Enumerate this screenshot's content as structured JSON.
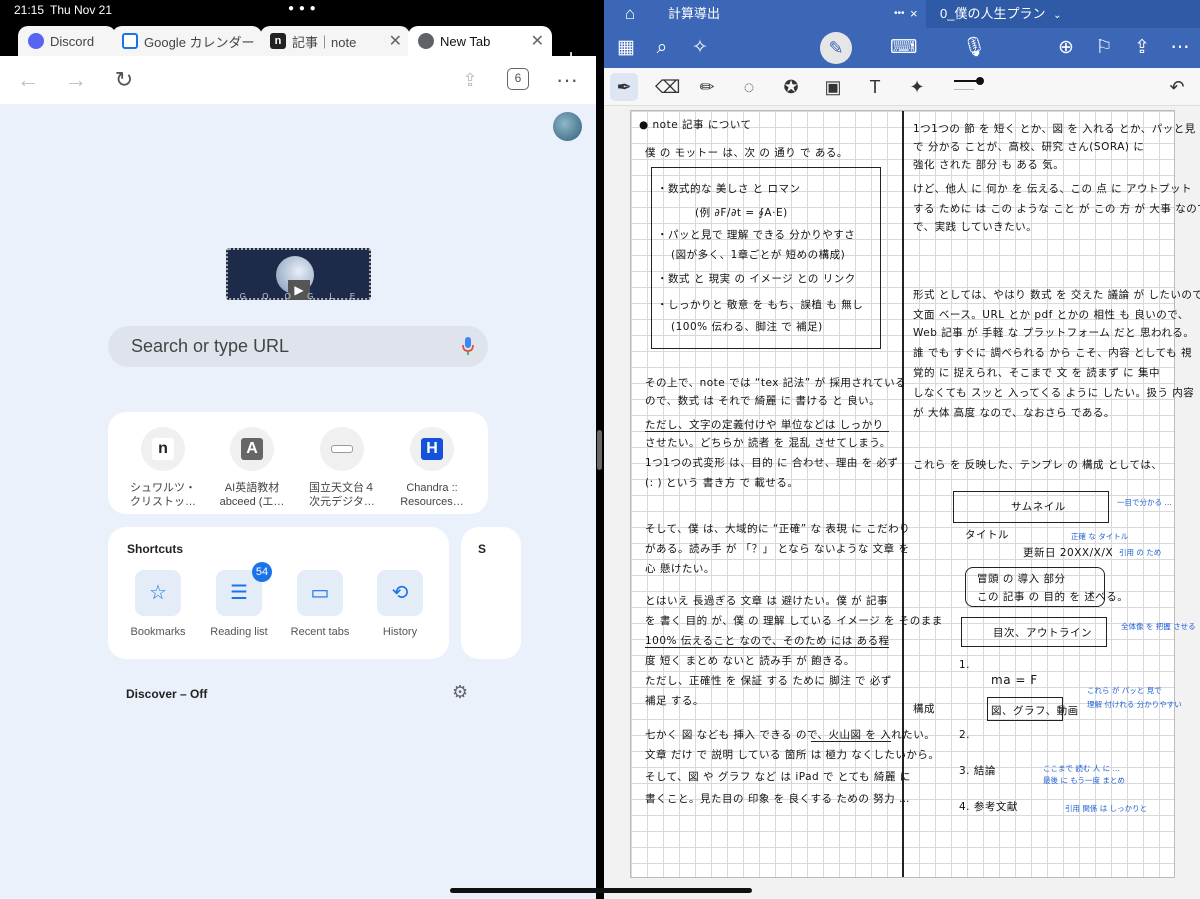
{
  "status": {
    "time": "21:15",
    "date": "Thu Nov 21"
  },
  "chrome": {
    "tabs": [
      {
        "title": "Discord",
        "color": "#5865f2"
      },
      {
        "title": "Google カレンダー",
        "color": "#1a73e8"
      },
      {
        "title": "記事｜note",
        "color": "#222222"
      },
      {
        "title": "New Tab",
        "color": "#5f6368"
      }
    ],
    "tab_count": "6",
    "search_placeholder": "Search or type URL",
    "tiles": [
      {
        "icon_text": "n",
        "label1": "シュワルツ・",
        "label2": "クリストッ…"
      },
      {
        "icon_text": "A",
        "label1": "AI英語教材",
        "label2": "abceed (エ…"
      },
      {
        "icon_text": "",
        "label1": "国立天文台４",
        "label2": "次元デジタ…"
      },
      {
        "icon_text": "H",
        "label1": "Chandra ::",
        "label2": "Resources…"
      }
    ],
    "shortcuts_title": "Shortcuts",
    "shortcuts": [
      {
        "label": "Bookmarks",
        "icon": "star-icon"
      },
      {
        "label": "Reading list",
        "icon": "list-icon",
        "badge": "54"
      },
      {
        "label": "Recent tabs",
        "icon": "devices-icon"
      },
      {
        "label": "History",
        "icon": "history-icon"
      }
    ],
    "next_card_title": "S",
    "discover": "Discover – Off",
    "doodle_letters": "G O O G L E"
  },
  "goodnotes": {
    "tabs": [
      {
        "title": "計算導出"
      },
      {
        "title": "0_僕の人生プラン"
      }
    ],
    "note_left": [
      "● note 記事 について",
      "僕 の モットー は、次 の 通り で ある。",
      "・数式的な 美しさ と ロマン",
      "(例 ∂F/∂t = ∮A·E)",
      "・パッと見で 理解 できる 分かりやすさ",
      "(図が多く、1章ごとが 短めの構成)",
      "・数式 と 現実 の イメージ との リンク",
      "・しっかりと 敬意 を もち、誤植 も 無し",
      "(100% 伝わる、脚注 で 補足)",
      "その上で、note では “tex 記法” が 採用されている",
      "ので、数式 は それで 綺麗 に 書ける と 良い。",
      "ただし、文字の定義付けや 単位などは しっかり",
      "させたい。どちらか 読者 を 混乱 させてしまう。",
      "1つ1つの式変形 は、目的 に 合わせ、理由 を 必ず",
      "(: ) という 書き方 で 載せる。",
      "そして、僕 は、大域的に “正確” な 表現 に こだわり",
      "がある。読み手 が 「？」 となら ないような 文章 を",
      "心 懸けたい。",
      "とはいえ 長過ぎる 文章 は 避けたい。僕 が 記事",
      "を 書く 目的 が、僕 の 理解 している イメージ を そのまま",
      "100% 伝えること なので、そのため には ある程",
      "度 短く まとめ ないと 読み手 が 飽きる。",
      "ただし、正確性 を 保証 する ために 脚注 で 必ず",
      "補足 する。",
      "七かく 図 なども 挿入 できる ので、火山図 を 入れたい。",
      "文章 だけ で 説明 している 箇所 は 極力 なくしたいから。",
      "そして、図 や グラフ など は iPad で とても 綺麗 に",
      "書くこと。見た目の 印象 を 良くする ための 努力 …"
    ],
    "note_right": [
      "1つ1つの 節 を 短く とか、図 を 入れる とか、パッと見",
      "で 分かる ことが、高校、研究 さん(SORA) に",
      "強化 された 部分 も ある 気。",
      "けど、他人 に 何か を 伝える、この 点 に アウトプット",
      "する ために は この ような こと が この 方 が 大事 なので、",
      "で、実践 していきたい。",
      "形式 としては、やはり 数式 を 交えた 議論 が したいので、",
      "文面 ベース。URL とか pdf とかの 相性 も 良いので、",
      "Web 記事 が 手軽 な プラットフォーム だと 思われる。",
      "誰 でも すぐに 調べられる から こそ、内容 としても 視",
      "覚的 に 捉えられ、そこまで 文 を 読まず に 集中",
      "しなくても スッと 入ってくる ように したい。扱う 内容",
      "が 大体 高度 なので、なおさら である。",
      "これら を 反映した、テンプレ の 構成 としては、",
      "サムネイル",
      "タイトル",
      "更新日 20XX/X/X",
      "冒頭 の 導入 部分",
      "この 記事 の 目的 を 述べる。",
      "目次、アウトライン",
      "1.",
      "mа = F",
      "図、グラフ、動画",
      "2.",
      "3. 結論",
      "4. 参考文献",
      "構成"
    ],
    "note_blue": [
      "一目で分かる …",
      "正確 な タイトル",
      "引用 の ため",
      "全体像 を 把握 させる",
      "これら が パッと 見で",
      "理解 付けれる 分かりやすい",
      "ここまで 読む 人 に …",
      "最後 に もう一度 まとめ",
      "引用 関係 は しっかりと"
    ]
  }
}
